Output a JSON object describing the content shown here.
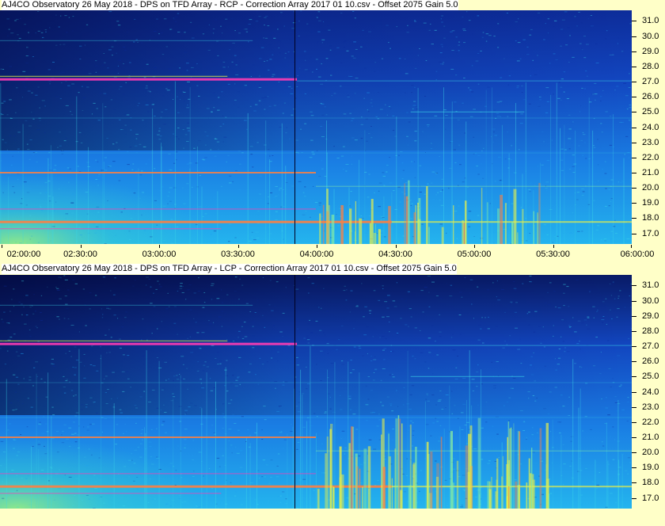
{
  "panels": [
    {
      "title": "AJ4CO Observatory 26 May 2018  -  DPS on TFD Array  -  RCP  -  Correction Array 2017 01 10.csv  -  Offset 2075  Gain 5.0"
    },
    {
      "title": "AJ4CO Observatory 26 May 2018  -  DPS on TFD Array  -  LCP  -  Correction Array 2017 01 10.csv  -  Offset 2075  Gain 5.0"
    }
  ],
  "chart_data": [
    {
      "type": "heatmap",
      "title": "AJ4CO Observatory 26 May 2018  -  DPS on TFD Array  -  RCP  -  Correction Array 2017 01 10.csv  -  Offset 2075  Gain 5.0",
      "polarization": "RCP",
      "xlim": [
        "02:00:00",
        "06:00:00"
      ],
      "x_ticks": [
        "02:00:00",
        "02:30:00",
        "03:00:00",
        "03:30:00",
        "04:00:00",
        "04:30:00",
        "05:00:00",
        "05:30:00",
        "06:00:00"
      ],
      "ylim": [
        16.3,
        31.7
      ],
      "y_ticks": [
        "17.0",
        "18.0",
        "19.0",
        "20.0",
        "21.0",
        "22.0",
        "23.0",
        "24.0",
        "25.0",
        "26.0",
        "27.0",
        "28.0",
        "29.0",
        "30.0",
        "31.0"
      ],
      "axis_position": "right",
      "colormap": [
        "#000033",
        "#0a2a9a",
        "#1a5ad8",
        "#1fa0f0",
        "#3cd8e8",
        "#8af0a0",
        "#e8f048",
        "#ff8040",
        "#ff3cb4",
        "#ffffff"
      ],
      "grid": false
    },
    {
      "type": "heatmap",
      "title": "AJ4CO Observatory 26 May 2018  -  DPS on TFD Array  -  LCP  -  Correction Array 2017 01 10.csv  -  Offset 2075  Gain 5.0",
      "polarization": "LCP",
      "xlim": [
        "02:00:00",
        "06:00:00"
      ],
      "x_ticks": [],
      "ylim": [
        16.3,
        31.7
      ],
      "y_ticks": [
        "17.0",
        "18.0",
        "19.0",
        "20.0",
        "21.0",
        "22.0",
        "23.0",
        "24.0",
        "25.0",
        "26.0",
        "27.0",
        "28.0",
        "29.0",
        "30.0",
        "31.0"
      ],
      "axis_position": "right",
      "colormap": [
        "#000033",
        "#0a2a9a",
        "#1a5ad8",
        "#1fa0f0",
        "#3cd8e8",
        "#8af0a0",
        "#e8f048",
        "#ff8040",
        "#ff3cb4",
        "#ffffff"
      ],
      "grid": false
    }
  ]
}
